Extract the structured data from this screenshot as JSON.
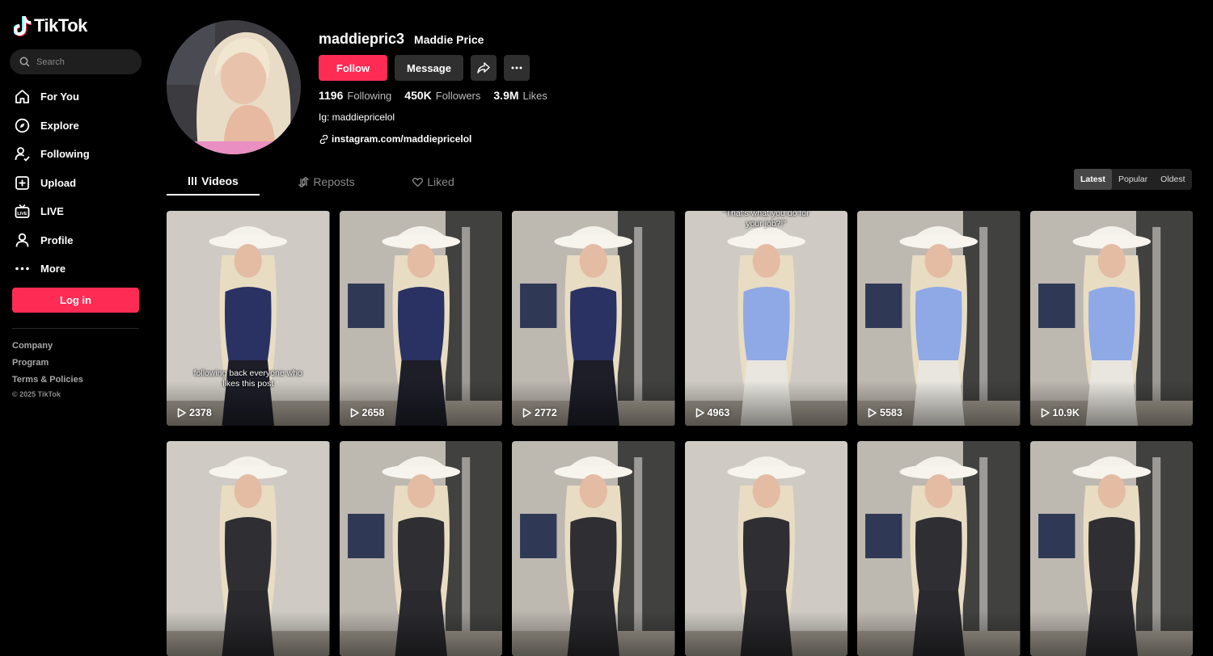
{
  "app": {
    "name": "TikTok"
  },
  "search": {
    "placeholder": "Search"
  },
  "nav": [
    {
      "label": "For You",
      "icon": "home-icon"
    },
    {
      "label": "Explore",
      "icon": "compass-icon"
    },
    {
      "label": "Following",
      "icon": "following-icon"
    },
    {
      "label": "Upload",
      "icon": "upload-icon"
    },
    {
      "label": "LIVE",
      "icon": "live-icon"
    },
    {
      "label": "Profile",
      "icon": "profile-icon"
    },
    {
      "label": "More",
      "icon": "more-icon"
    }
  ],
  "login_label": "Log in",
  "footer": {
    "links": [
      "Company",
      "Program",
      "Terms & Policies"
    ],
    "copyright": "© 2025 TikTok"
  },
  "profile": {
    "username": "maddiepric3",
    "nickname": "Maddie Price",
    "follow_label": "Follow",
    "message_label": "Message",
    "stats": {
      "following": {
        "value": "1196",
        "label": "Following"
      },
      "followers": {
        "value": "450K",
        "label": "Followers"
      },
      "likes": {
        "value": "3.9M",
        "label": "Likes"
      }
    },
    "bio": "Ig: maddiepricelol",
    "link": "instagram.com/maddiepricelol"
  },
  "tabs": {
    "videos": "Videos",
    "reposts": "Reposts",
    "liked": "Liked"
  },
  "sort": {
    "latest": "Latest",
    "popular": "Popular",
    "oldest": "Oldest",
    "selected": "Latest"
  },
  "videos": [
    {
      "views": "2378",
      "caption": "following back everyone who likes this post",
      "top": "blue-longsleeve",
      "caption_pos": "bottom"
    },
    {
      "views": "2658",
      "caption": "",
      "top": "blue-longsleeve"
    },
    {
      "views": "2772",
      "caption": "",
      "top": "blue-longsleeve"
    },
    {
      "views": "4963",
      "caption": "\"That's what you do for your job?!\"",
      "top": "light-blue",
      "caption_pos": "top"
    },
    {
      "views": "5583",
      "caption": "",
      "top": "light-blue"
    },
    {
      "views": "10.9K",
      "caption": "",
      "top": "light-blue"
    },
    {
      "views": "",
      "caption": "",
      "top": "dark-grey"
    },
    {
      "views": "",
      "caption": "",
      "top": "dark-grey"
    },
    {
      "views": "",
      "caption": "",
      "top": "dark-grey"
    },
    {
      "views": "",
      "caption": "",
      "top": "dark-grey"
    },
    {
      "views": "",
      "caption": "",
      "top": "dark-grey"
    },
    {
      "views": "",
      "caption": "",
      "top": "dark-grey"
    }
  ],
  "colors": {
    "accent": "#fe2c55",
    "background": "#000000",
    "panel": "#2f2f2f"
  }
}
